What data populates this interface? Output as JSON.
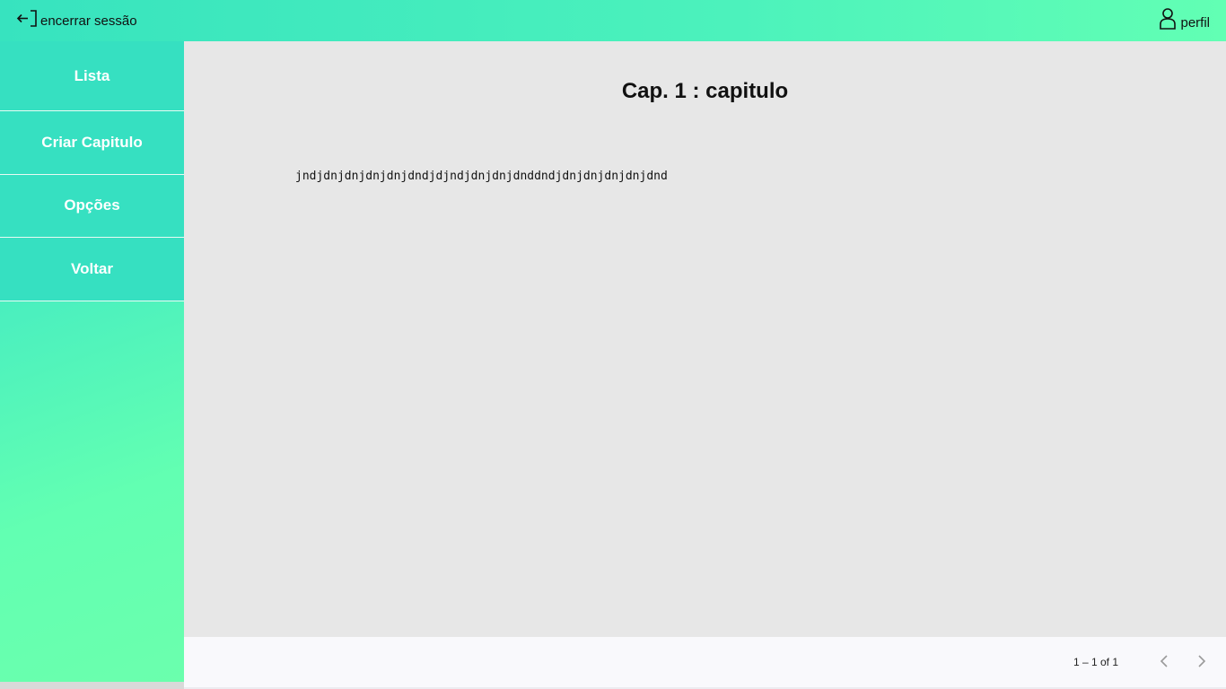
{
  "header": {
    "logout_label": "encerrar sessão",
    "profile_label": "perfil"
  },
  "sidebar": {
    "items": [
      {
        "label": "Lista"
      },
      {
        "label": "Criar Capitulo"
      },
      {
        "label": "Opções"
      },
      {
        "label": "Voltar"
      }
    ]
  },
  "main": {
    "title": "Cap. 1 : capitulo",
    "body": "jndjdnjdnjdnjdnjdndjdjndjdnjdnjdnddndjdnjdnjdnjdnjdnd"
  },
  "paginator": {
    "range": "1 – 1 of 1"
  },
  "colors": {
    "accent": "#36e0c1",
    "accent_light": "#62ffb4"
  },
  "icons": {
    "logout": "logout-icon",
    "profile": "user-icon",
    "prev": "chevron-left-icon",
    "next": "chevron-right-icon"
  }
}
